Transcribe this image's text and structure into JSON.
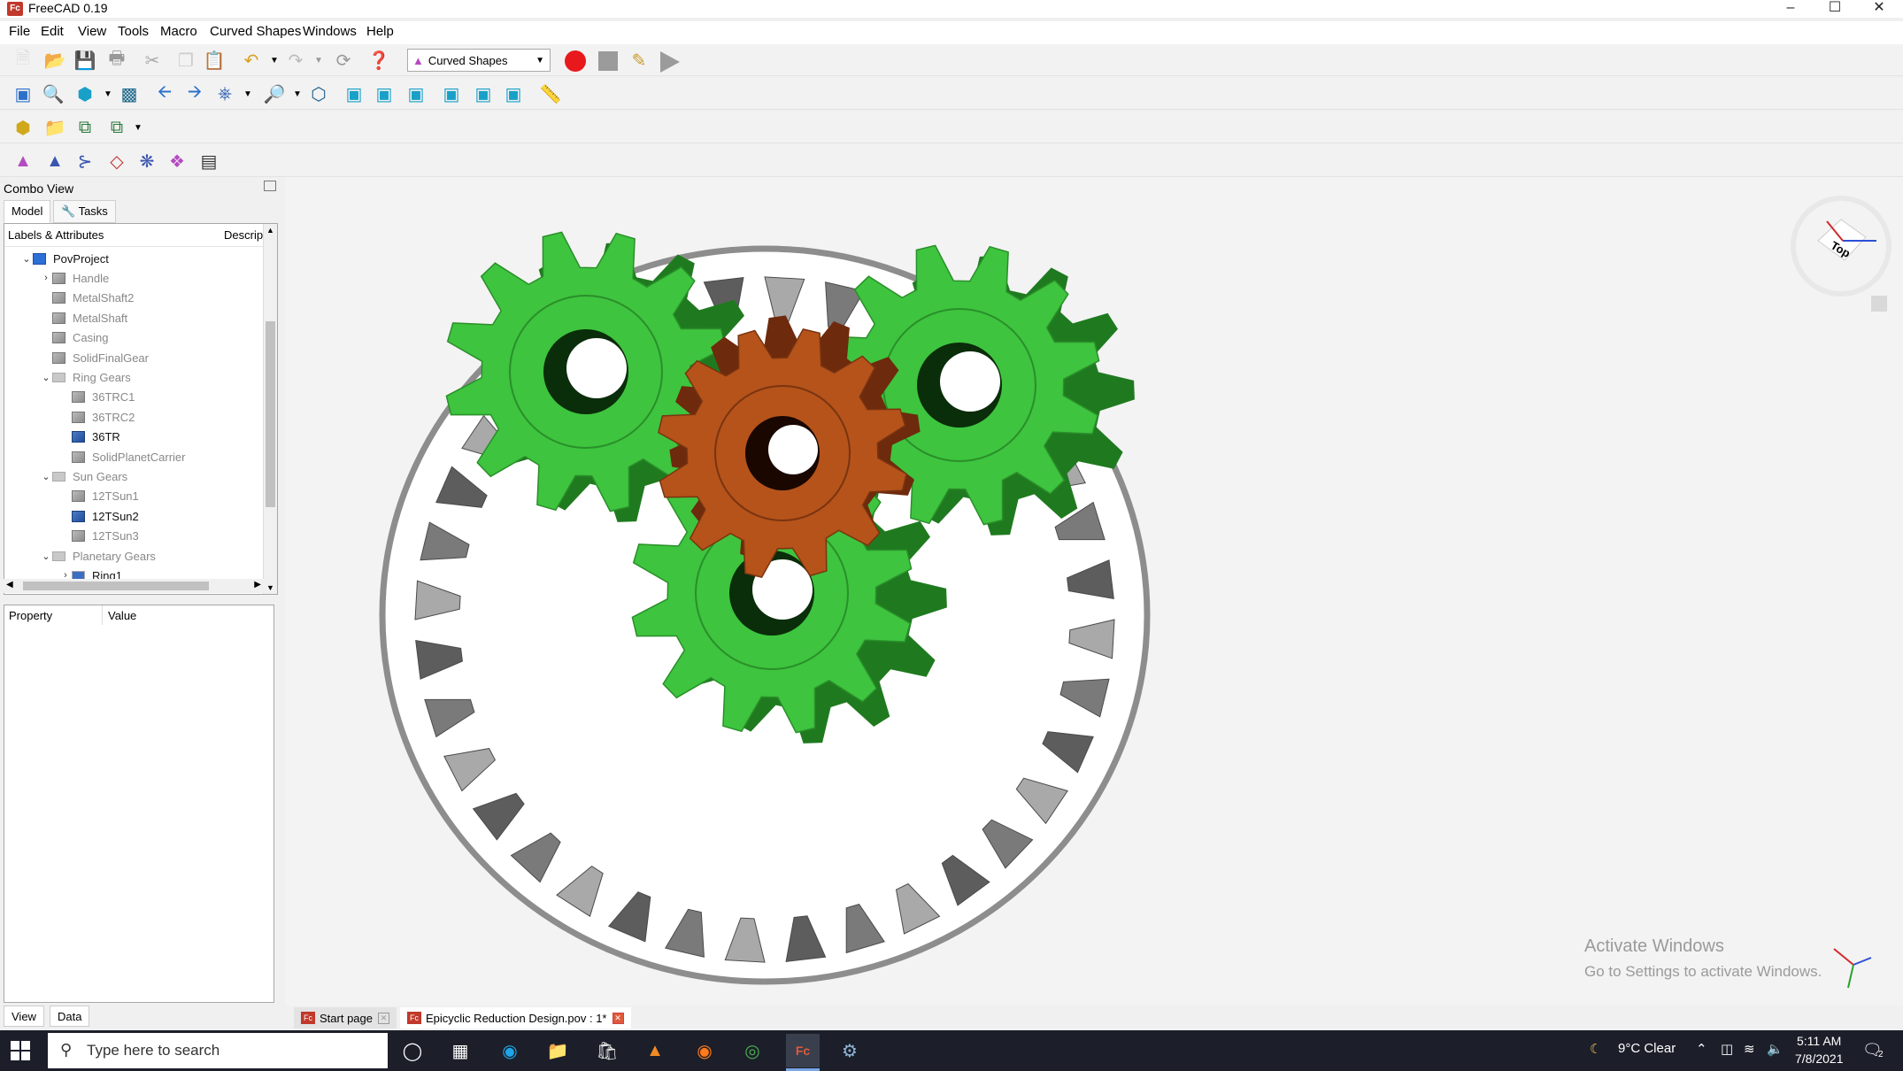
{
  "window": {
    "title": "FreeCAD 0.19",
    "app_icon_text": "Fc",
    "controls": [
      "minimize-icon",
      "maximize-icon",
      "close-icon"
    ]
  },
  "menu": [
    "File",
    "Edit",
    "View",
    "Tools",
    "Macro",
    "Curved Shapes",
    "Windows",
    "Help"
  ],
  "toolbar": {
    "workbench_selected": "Curved Shapes",
    "record_color": "#e8191c"
  },
  "combo": {
    "title": "Combo View",
    "tabs": [
      "Model",
      "Tasks"
    ],
    "tree_header_labels": "Labels & Attributes",
    "tree_header_desc": "Descrip",
    "items": [
      {
        "label": "PovProject",
        "level": 0,
        "arrow": "expanded",
        "icon": "project",
        "dark": true
      },
      {
        "label": "Handle",
        "level": 1,
        "arrow": "collapsed",
        "icon": "part",
        "dark": false
      },
      {
        "label": "MetalShaft2",
        "level": 1,
        "arrow": "",
        "icon": "part",
        "dark": false
      },
      {
        "label": "MetalShaft",
        "level": 1,
        "arrow": "",
        "icon": "part",
        "dark": false
      },
      {
        "label": "Casing",
        "level": 1,
        "arrow": "",
        "icon": "part",
        "dark": false
      },
      {
        "label": "SolidFinalGear",
        "level": 1,
        "arrow": "",
        "icon": "part",
        "dark": false
      },
      {
        "label": "Ring Gears",
        "level": 1,
        "arrow": "expanded",
        "icon": "folder",
        "dark": false
      },
      {
        "label": "36TRC1",
        "level": 2,
        "arrow": "",
        "icon": "part",
        "dark": false
      },
      {
        "label": "36TRC2",
        "level": 2,
        "arrow": "",
        "icon": "part",
        "dark": false
      },
      {
        "label": "36TR",
        "level": 2,
        "arrow": "",
        "icon": "part-blue",
        "dark": true
      },
      {
        "label": "SolidPlanetCarrier",
        "level": 2,
        "arrow": "",
        "icon": "part",
        "dark": false
      },
      {
        "label": "Sun Gears",
        "level": 1,
        "arrow": "expanded",
        "icon": "folder",
        "dark": false
      },
      {
        "label": "12TSun1",
        "level": 2,
        "arrow": "",
        "icon": "part",
        "dark": false
      },
      {
        "label": "12TSun2",
        "level": 2,
        "arrow": "",
        "icon": "part-blue",
        "dark": true
      },
      {
        "label": "12TSun3",
        "level": 2,
        "arrow": "",
        "icon": "part",
        "dark": false
      },
      {
        "label": "Planetary Gears",
        "level": 1,
        "arrow": "expanded",
        "icon": "folder",
        "dark": false
      },
      {
        "label": "Ring1",
        "level": 2,
        "arrow": "collapsed",
        "icon": "folder-blue",
        "dark": true
      }
    ],
    "property_header": "Property",
    "value_header": "Value",
    "bottom_tabs": [
      "View",
      "Data"
    ]
  },
  "view3d": {
    "navcube_face": "Top",
    "watermark_title": "Activate Windows",
    "watermark_sub": "Go to Settings to activate Windows.",
    "colors": {
      "planet": "#3ec43e",
      "planet_dark": "#1f7a1f",
      "sun": "#b5531a",
      "ring": "#8a8a8a"
    }
  },
  "doc_tabs": [
    {
      "label": "Start page",
      "active": false
    },
    {
      "label": "Epicyclic Reduction Design.pov : 1*",
      "active": true
    }
  ],
  "taskbar": {
    "search_placeholder": "Type here to search",
    "weather": "9°C  Clear",
    "time": "5:11 AM",
    "date": "7/8/2021",
    "notifications": "2"
  }
}
